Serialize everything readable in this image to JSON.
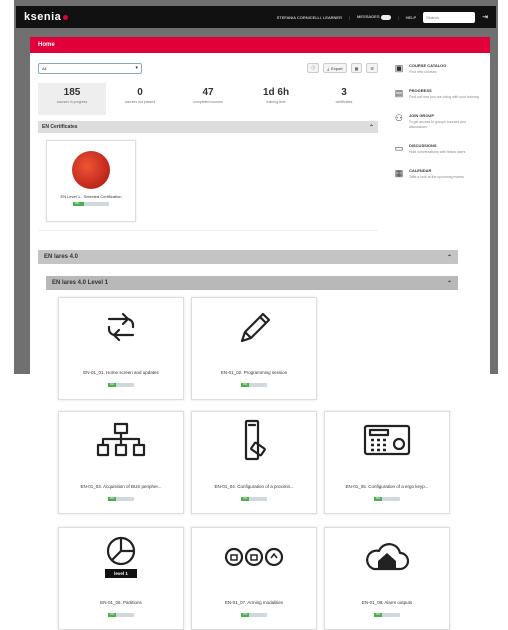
{
  "header": {
    "logo": "ksenia",
    "user": "STEFANIA CORNICELLI, LEARNER",
    "messages": "MESSAGES",
    "help": "HELP",
    "search_placeholder": "Search",
    "exit_icon": "exit-icon"
  },
  "page_title": "Home",
  "filter": {
    "value": "All"
  },
  "toolbar": {
    "export_label": "Export"
  },
  "stats": [
    {
      "value": "185",
      "label": "courses in progress"
    },
    {
      "value": "0",
      "label": "courses not passed"
    },
    {
      "value": "47",
      "label": "completed courses"
    },
    {
      "value": "1d 6h",
      "label": "training time"
    },
    {
      "value": "3",
      "label": "certificates"
    }
  ],
  "certificates": {
    "title": "EN Certificates",
    "items": [
      {
        "title": "EN Level 1 - Selected Certification",
        "progress_label": "0%",
        "progress": 0.3
      }
    ]
  },
  "sidebar": [
    {
      "icon": "book-icon",
      "title": "COURSE CATALOG",
      "desc": "Find new courses"
    },
    {
      "icon": "chart-icon",
      "title": "PROGRESS",
      "desc": "Find out how you are doing with your training"
    },
    {
      "icon": "group-icon",
      "title": "JOIN GROUP",
      "desc": "To get access to groups courses and discussions"
    },
    {
      "icon": "chat-icon",
      "title": "DISCUSSIONS",
      "desc": "Hold conversations with fellow users"
    },
    {
      "icon": "calendar-icon",
      "title": "CALENDAR",
      "desc": "Take a look at the upcoming events"
    }
  ],
  "sections": {
    "lares": "EN lares 4.0",
    "lares_level1": "EN lares 4.0 Level 1"
  },
  "courses": [
    {
      "icon": "sync-icon",
      "title": "EN-01_01. Home screen and updates",
      "progress_label": "0%",
      "progress": 0.3
    },
    {
      "icon": "pencil-icon",
      "title": "EN-01_02. Programming session",
      "progress_label": "0%",
      "progress": 0.3
    },
    {
      "icon": "network-icon",
      "title": "EN-01_03. Acquisition of BUS peripher...",
      "progress_label": "0%",
      "progress": 0.3
    },
    {
      "icon": "proximity-reader-icon",
      "title": "EN-01_04. Configuration of a proximit...",
      "progress_label": "0%",
      "progress": 0.3
    },
    {
      "icon": "keypad-icon",
      "title": "EN-01_05. Configuration of a ergo keyp...",
      "progress_label": "0%",
      "progress": 0.3
    },
    {
      "icon": "pie-level-icon",
      "title": "EN-01_06. Partitions",
      "progress_label": "0%",
      "progress": 0.3,
      "badge": "level 1"
    },
    {
      "icon": "arming-icon",
      "title": "EN-01_07. Arming modalities",
      "progress_label": "0%",
      "progress": 0.3
    },
    {
      "icon": "cloud-house-icon",
      "title": "EN-01_08. Alarm outputs",
      "progress_label": "0%",
      "progress": 0.3
    }
  ]
}
